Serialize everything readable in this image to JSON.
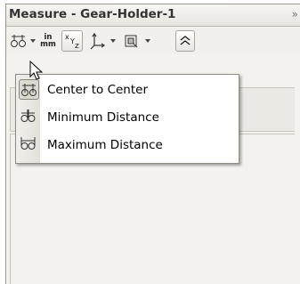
{
  "window": {
    "title": "Measure - Gear-Holder-1"
  },
  "toolbar": {
    "units_icon_top": "in",
    "units_icon_bottom": "mm",
    "buttons": [
      "distance-mode-icon",
      "units-icon",
      "xyz-icon",
      "axis-icon",
      "view-icon",
      "collapse-icon"
    ]
  },
  "menu": {
    "items": [
      {
        "label": "Center to Center",
        "icon": "center-to-center-icon",
        "selected": true
      },
      {
        "label": "Minimum Distance",
        "icon": "minimum-distance-icon",
        "selected": false
      },
      {
        "label": "Maximum Distance",
        "icon": "maximum-distance-icon",
        "selected": false
      }
    ]
  }
}
